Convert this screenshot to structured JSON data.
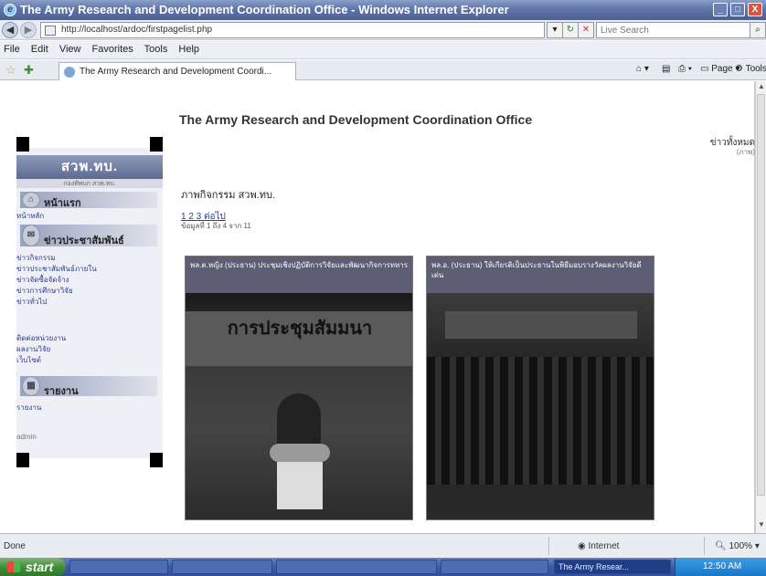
{
  "window": {
    "title": "The Army Research and Development Coordination Office - Windows Internet Explorer",
    "minimize": "_",
    "maximize": "□",
    "close": "X"
  },
  "address_bar": {
    "url": "http://localhost/ardoc/firstpagelist.php",
    "search_placeholder": "Live Search"
  },
  "menu": [
    "File",
    "Edit",
    "View",
    "Favorites",
    "Tools",
    "Help"
  ],
  "tab": {
    "label": "The Army Research and Development Coordi..."
  },
  "command_bar": {
    "page": "Page",
    "tools": "Tools"
  },
  "page": {
    "site_title": "The Army Research and Development Coordination Office",
    "logo_text": "สวพ.ทบ.",
    "logo_sub": "กองทัพบก สวพ.ทบ.",
    "sidebar": {
      "section1": "หน้าแรก",
      "section1_links": [
        "หน้าหลัก"
      ],
      "section2": "ข่าวประชาสัมพันธ์",
      "section2_links": [
        "ข่าวกิจกรรม",
        "ข่าวประชาสัมพันธ์ภายใน",
        "ข่าวจัดซื้อจัดจ้าง",
        "ข่าวการศึกษาวิจัย",
        "ข่าวทั่วไป"
      ],
      "section2_links_b": [
        "ติดต่อหน่วยงาน",
        "ผลงานวิจัย",
        "เว็บไซต์"
      ],
      "section3": "รายงาน",
      "section3_links": [
        "รายงาน"
      ],
      "footer": "admin"
    },
    "right_link": "ข่าวทั้งหมด",
    "right_link_sub": "(ภาพ)",
    "section_title": "ภาพกิจกรรม สวพ.ทบ.",
    "pagination": "1 2 3 ต่อไป",
    "page_info": "ข้อมูลที่ 1 ถึง 4 จาก 11",
    "cards": [
      {
        "caption": "พล.ต.หญิง (ประธาน) ประชุมเชิงปฏิบัติการวิจัยและพัฒนากิจการทหาร"
      },
      {
        "caption": "พล.อ. (ประธาน) ให้เกียรติเป็นประธานในพิธีมอบรางวัลผลงานวิจัยดีเด่น"
      }
    ],
    "photo1_banner": "การประชุมสัมมนา"
  },
  "status": {
    "done": "Done",
    "zone": "Internet",
    "zoom": "100%"
  },
  "taskbar": {
    "start": "start",
    "buttons": [
      "",
      "",
      "",
      "",
      ""
    ],
    "active": "The Army Resear...",
    "time": "12:50 AM"
  }
}
